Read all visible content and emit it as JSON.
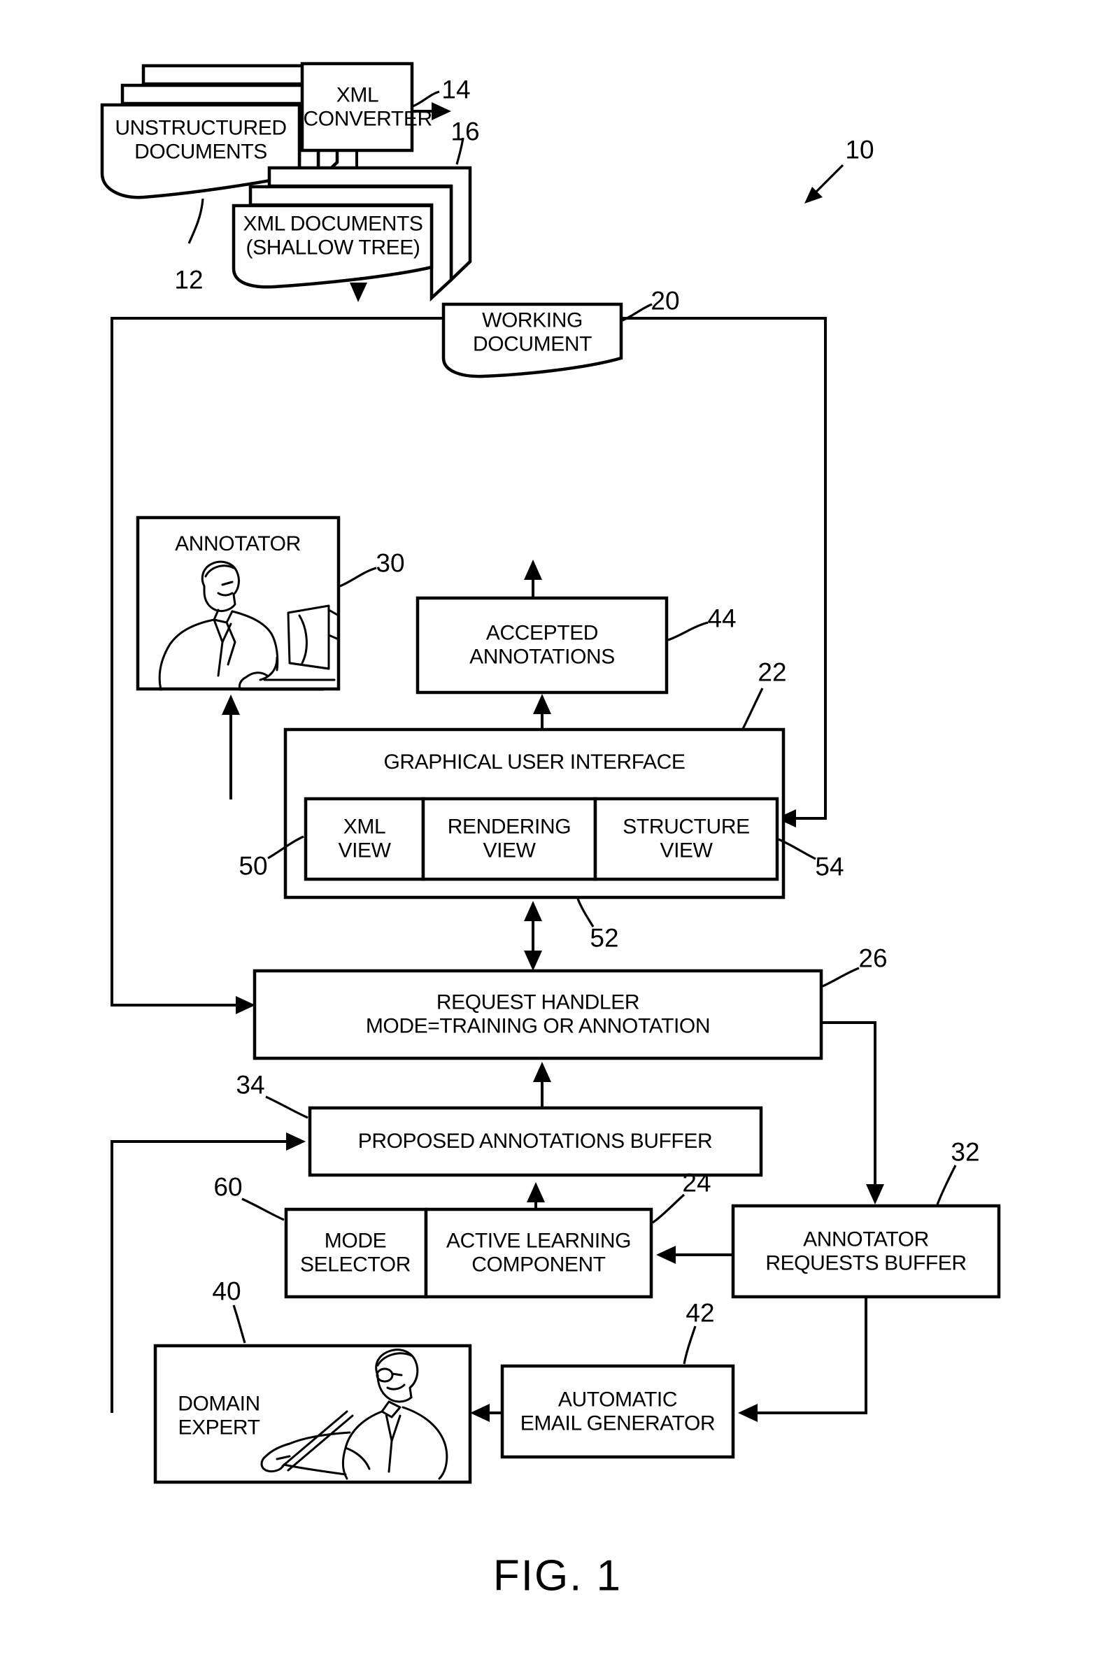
{
  "figure": {
    "caption": "FIG. 1",
    "system_ref": "10"
  },
  "nodes": {
    "unstructured_documents": {
      "label": "UNSTRUCTURED\nDOCUMENTS",
      "ref": "12"
    },
    "xml_converter": {
      "label": "XML\nCONVERTER",
      "ref": "14"
    },
    "xml_documents": {
      "label": "XML DOCUMENTS\n(SHALLOW TREE)",
      "ref": "16"
    },
    "working_document": {
      "label": "WORKING\nDOCUMENT",
      "ref": "20"
    },
    "annotator": {
      "label": "ANNOTATOR",
      "ref": "30",
      "icon": "person-at-computer-icon"
    },
    "accepted_annotations": {
      "label": "ACCEPTED\nANNOTATIONS",
      "ref": "44"
    },
    "graphical_user_interface": {
      "label": "GRAPHICAL USER INTERFACE",
      "ref": "22"
    },
    "xml_view": {
      "label": "XML\nVIEW",
      "ref": "50"
    },
    "rendering_view": {
      "label": "RENDERING\nVIEW",
      "ref": "52"
    },
    "structure_view": {
      "label": "STRUCTURE\nVIEW",
      "ref": "54"
    },
    "request_handler": {
      "label": "REQUEST HANDLER\nMODE=TRAINING OR ANNOTATION",
      "ref": "26"
    },
    "proposed_annotations_buffer": {
      "label": "PROPOSED ANNOTATIONS BUFFER",
      "ref": "34"
    },
    "mode_selector": {
      "label": "MODE\nSELECTOR",
      "ref": "60"
    },
    "active_learning_component": {
      "label": "ACTIVE LEARNING\nCOMPONENT",
      "ref": "24"
    },
    "annotator_requests_buffer": {
      "label": "ANNOTATOR\nREQUESTS BUFFER",
      "ref": "32"
    },
    "automatic_email_generator": {
      "label": "AUTOMATIC\nEMAIL GENERATOR",
      "ref": "42"
    },
    "domain_expert": {
      "label": "DOMAIN\nEXPERT",
      "ref": "40",
      "icon": "person-with-pointer-icon"
    }
  },
  "reference_numerals": [
    "10",
    "12",
    "14",
    "16",
    "20",
    "22",
    "24",
    "26",
    "30",
    "32",
    "34",
    "40",
    "42",
    "44",
    "50",
    "52",
    "54",
    "60"
  ],
  "colors": {
    "ink": "#000000",
    "paper": "#ffffff"
  }
}
